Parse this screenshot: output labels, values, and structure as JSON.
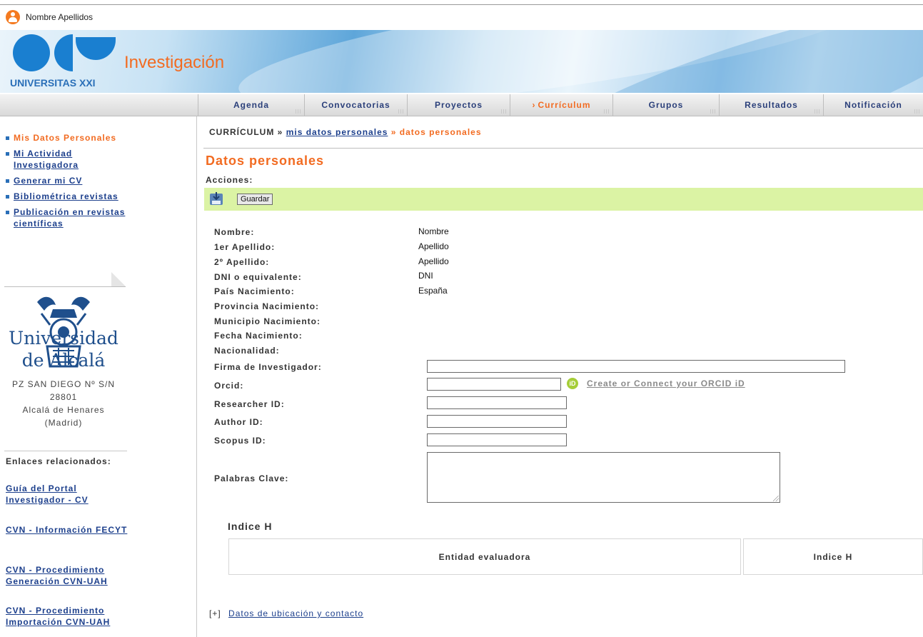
{
  "user": {
    "name": "Nombre Apellidos",
    "icon": "user-icon"
  },
  "banner": {
    "logo_text": "UNIVERSITAS XXI",
    "title": "Investigación"
  },
  "nav": {
    "tabs": [
      {
        "label": "Agenda"
      },
      {
        "label": "Convocatorias"
      },
      {
        "label": "Proyectos"
      },
      {
        "label": "Currículum",
        "active": true
      },
      {
        "label": "Grupos"
      },
      {
        "label": "Resultados"
      },
      {
        "label": "Notificación"
      }
    ]
  },
  "sidebar": {
    "menu": [
      {
        "label": "Mis Datos Personales",
        "active": true
      },
      {
        "label": "Mi Actividad Investigadora"
      },
      {
        "label": "Generar mi CV"
      },
      {
        "label": "Bibliométrica revistas"
      },
      {
        "label": "Publicación en revistas científicas"
      }
    ],
    "university": {
      "line1": "Universidad",
      "line2": "de Alcalá"
    },
    "address": [
      "PZ SAN DIEGO Nº S/N",
      "28801",
      "Alcalá de Henares",
      "(Madrid)"
    ],
    "related_title": "Enlaces relacionados:",
    "related_links": [
      "Guía del Portal Investigador - CV",
      "CVN - Información FECYT",
      "CVN - Procedimiento Generación CVN-UAH",
      "CVN - Procedimiento Importación CVN-UAH"
    ]
  },
  "breadcrumb": {
    "root": "CURRÍCULUM",
    "sep": "»",
    "middle": "mis datos personales",
    "current": "datos personales"
  },
  "page": {
    "title": "Datos personales",
    "actions_label": "Acciones:",
    "save_label": "Guardar",
    "fields": {
      "nombre": {
        "label": "Nombre:",
        "value": "Nombre"
      },
      "apellido1": {
        "label": "1er Apellido:",
        "value": "Apellido"
      },
      "apellido2": {
        "label": "2º Apellido:",
        "value": "Apellido"
      },
      "dni": {
        "label": "DNI o equivalente:",
        "value": "DNI"
      },
      "pais": {
        "label": "País Nacimiento:",
        "value": "España"
      },
      "provincia": {
        "label": "Provincia Nacimiento:",
        "value": ""
      },
      "municipio": {
        "label": "Municipio Nacimiento:",
        "value": ""
      },
      "fecha": {
        "label": "Fecha Nacimiento:",
        "value": ""
      },
      "nacionalidad": {
        "label": "Nacionalidad:",
        "value": ""
      },
      "firma": {
        "label": "Firma de Investigador:",
        "value": ""
      },
      "orcid": {
        "label": "Orcid:",
        "value": "",
        "link": "Create or Connect your ORCID iD"
      },
      "researcher_id": {
        "label": "Researcher ID:",
        "value": ""
      },
      "author_id": {
        "label": "Author ID:",
        "value": ""
      },
      "scopus_id": {
        "label": "Scopus ID:",
        "value": ""
      },
      "palabras_clave": {
        "label": "Palabras Clave:",
        "value": ""
      }
    },
    "indice_h": {
      "title": "Indice H",
      "columns": [
        "Entidad evaluadora",
        "Indice H"
      ]
    },
    "expand": {
      "toggle": "[+]",
      "label": "Datos de ubicación y contacto"
    }
  },
  "colors": {
    "accent": "#f26b21",
    "link": "#1c3f8c",
    "action_bar": "#dbf3a4",
    "orcid": "#a6ce39"
  }
}
